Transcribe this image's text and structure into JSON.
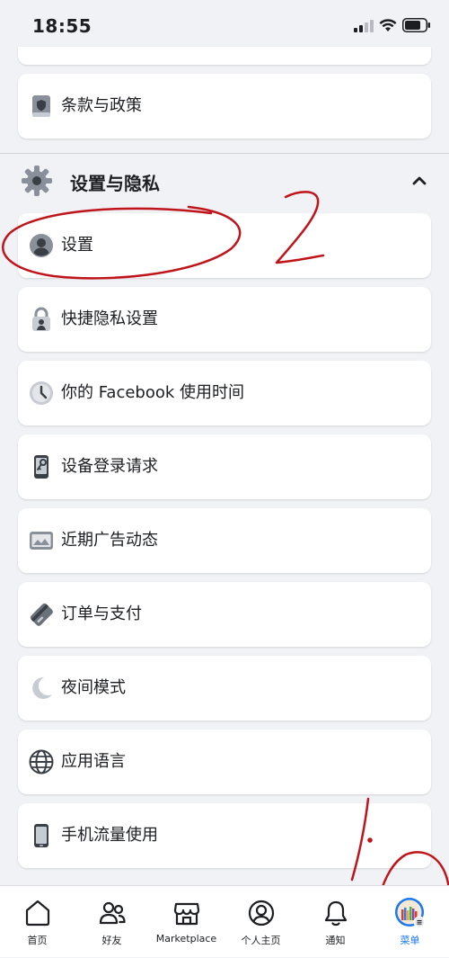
{
  "status_bar": {
    "time": "18:55"
  },
  "cards_top": {
    "terms_label": "条款与政策",
    "terms_icon": "shield-book-icon"
  },
  "section": {
    "title": "设置与隐私",
    "icon": "gear-icon",
    "expanded": true
  },
  "settings_items": [
    {
      "label": "设置",
      "icon": "person-circle-icon"
    },
    {
      "label": "快捷隐私设置",
      "icon": "lock-person-icon"
    },
    {
      "label": "你的 Facebook 使用时间",
      "icon": "clock-icon"
    },
    {
      "label": "设备登录请求",
      "icon": "phone-key-icon"
    },
    {
      "label": "近期广告动态",
      "icon": "ad-activity-icon"
    },
    {
      "label": "订单与支付",
      "icon": "credit-card-icon"
    },
    {
      "label": "夜间模式",
      "icon": "moon-icon"
    },
    {
      "label": "应用语言",
      "icon": "globe-icon"
    },
    {
      "label": "手机流量使用",
      "icon": "mobile-phone-icon"
    }
  ],
  "annotations": {
    "step_two": "2",
    "step_one": "1."
  },
  "bottom_nav": [
    {
      "label": "首页",
      "icon": "home-icon",
      "active": false
    },
    {
      "label": "好友",
      "icon": "friends-icon",
      "active": false
    },
    {
      "label": "Marketplace",
      "icon": "marketplace-icon",
      "active": false
    },
    {
      "label": "个人主页",
      "icon": "profile-icon",
      "active": false
    },
    {
      "label": "通知",
      "icon": "bell-icon",
      "active": false
    },
    {
      "label": "菜单",
      "icon": "menu-avatar-icon",
      "active": true
    }
  ],
  "colors": {
    "background": "#f0f2f5",
    "card": "#ffffff",
    "accent": "#1877f2",
    "annotation": "#c0141b"
  }
}
